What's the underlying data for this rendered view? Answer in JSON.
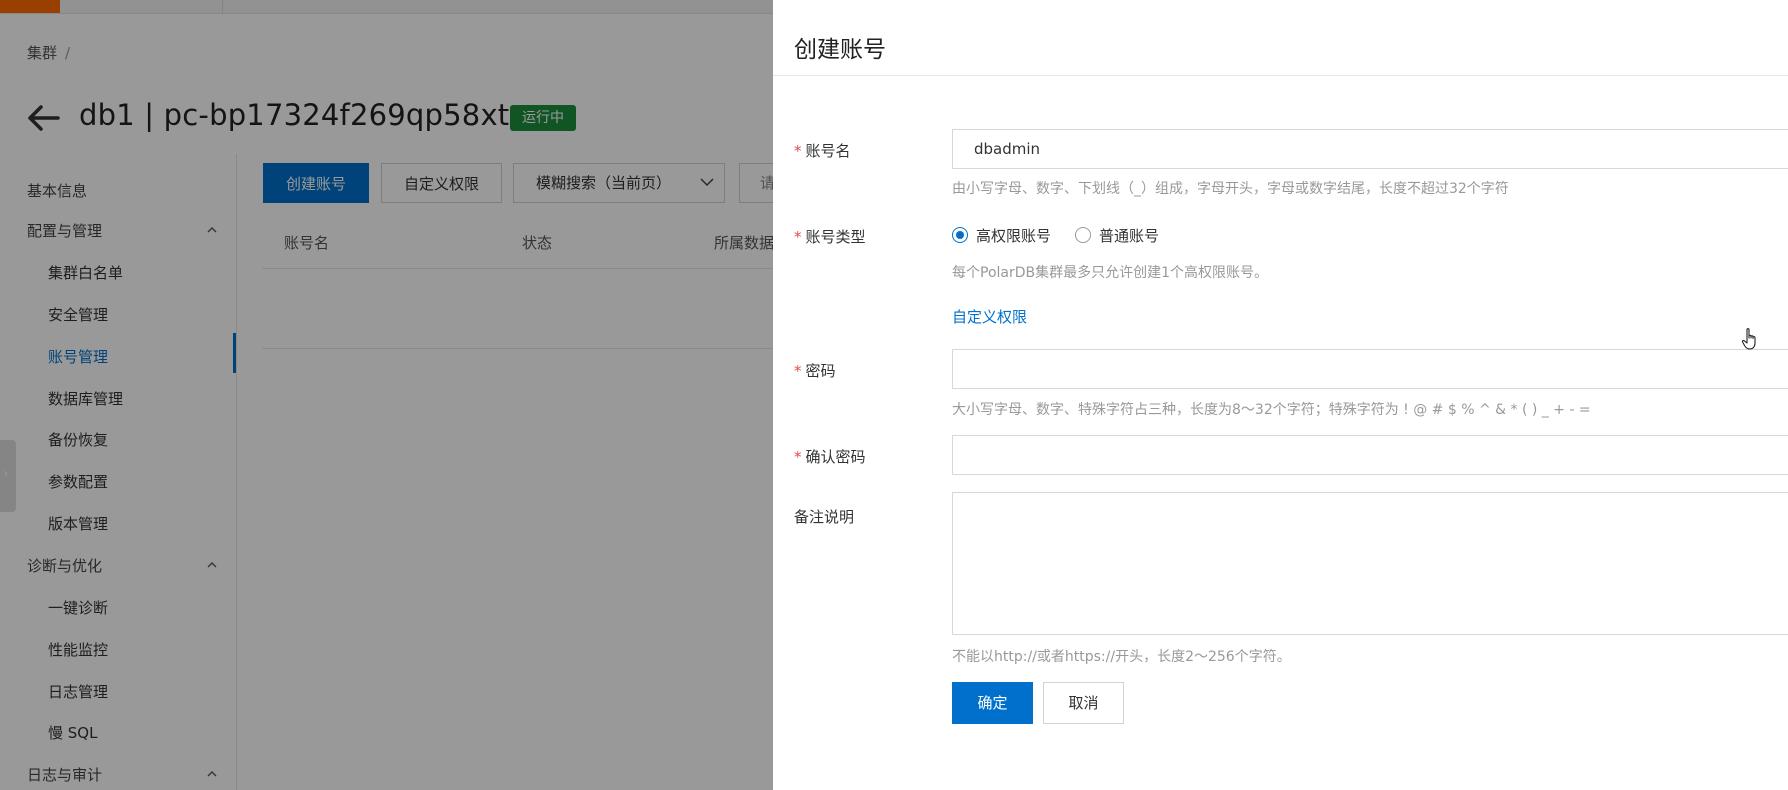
{
  "breadcrumb": {
    "root": "集群",
    "separator": "/"
  },
  "header": {
    "title": "db1 | pc-bp17324f269qp58xt",
    "status": "运行中",
    "status_color": "#1e8e3e"
  },
  "sidebar": {
    "basic": "基本信息",
    "groups": [
      {
        "label": "配置与管理",
        "items": [
          "集群白名单",
          "安全管理",
          "账号管理",
          "数据库管理",
          "备份恢复",
          "参数配置",
          "版本管理"
        ]
      },
      {
        "label": "诊断与优化",
        "items": [
          "一键诊断",
          "性能监控",
          "日志管理",
          "慢 SQL"
        ]
      },
      {
        "label": "日志与审计",
        "items": []
      }
    ],
    "active_item": "账号管理"
  },
  "toolbar": {
    "create_account": "创建账号",
    "custom_permission": "自定义权限",
    "search_mode": "模糊搜索（当前页）",
    "search_input_partial": "请"
  },
  "table": {
    "columns": [
      "账号名",
      "状态",
      "所属数据"
    ]
  },
  "drawer": {
    "title": "创建账号",
    "fields": {
      "account_name": {
        "label": "账号名",
        "value": "dbadmin",
        "hint": "由小写字母、数字、下划线（_）组成，字母开头，字母或数字结尾，长度不超过32个字符"
      },
      "account_type": {
        "label": "账号类型",
        "options": [
          "高权限账号",
          "普通账号"
        ],
        "selected": "高权限账号",
        "hint": "每个PolarDB集群最多只允许创建1个高权限账号。"
      },
      "custom_permission_link": "自定义权限",
      "password": {
        "label": "密码",
        "value": "",
        "hint": "大小写字母、数字、特殊字符占三种，长度为8～32个字符；特殊字符为 ! @ # $ % ^ & * ( ) _ + - ="
      },
      "confirm_password": {
        "label": "确认密码",
        "value": ""
      },
      "remark": {
        "label": "备注说明",
        "value": "",
        "hint": "不能以http://或者https://开头，长度2～256个字符。"
      }
    },
    "buttons": {
      "ok": "确定",
      "cancel": "取消"
    }
  },
  "colors": {
    "primary": "#0070cc",
    "required": "#e34b4b",
    "brand": "#ff6a00"
  },
  "icons": [
    "back-arrow-icon",
    "chevron-up-icon",
    "chevron-down-icon",
    "chevron-right-icon",
    "hand-cursor-icon"
  ]
}
